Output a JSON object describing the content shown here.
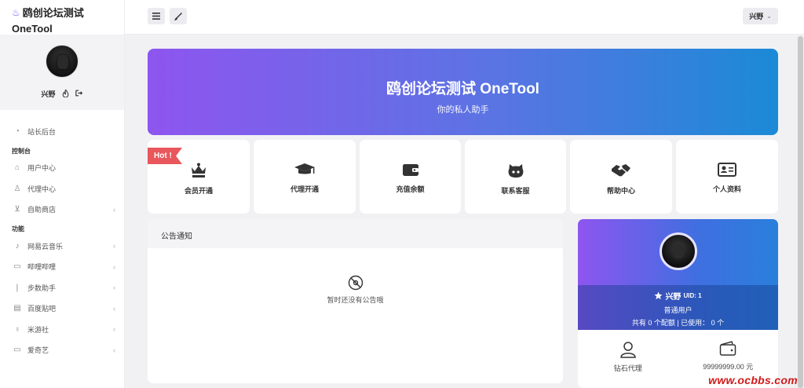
{
  "brand": {
    "title": "鸥创论坛测试",
    "subtitle": "OneTool"
  },
  "user": {
    "name": "兴野"
  },
  "sidebar": {
    "items": [
      {
        "label": "站长后台"
      }
    ],
    "group1": "控制台",
    "control": [
      {
        "label": "用户中心"
      },
      {
        "label": "代理中心"
      },
      {
        "label": "自助商店"
      }
    ],
    "group2": "功能",
    "functions": [
      {
        "label": "网易云音乐"
      },
      {
        "label": "哔哩哔哩"
      },
      {
        "label": "步数助手"
      },
      {
        "label": "百度贴吧"
      },
      {
        "label": "米游社"
      },
      {
        "label": "爱奇艺"
      }
    ]
  },
  "topbar": {
    "user_label": "兴野"
  },
  "hero": {
    "title": "鸥创论坛测试 OneTool",
    "subtitle": "你的私人助手"
  },
  "hot_label": "Hot !",
  "tiles": [
    {
      "label": "会员开通"
    },
    {
      "label": "代理开通"
    },
    {
      "label": "充值余额"
    },
    {
      "label": "联系客服"
    },
    {
      "label": "帮助中心"
    },
    {
      "label": "个人资料"
    }
  ],
  "notice": {
    "title": "公告通知",
    "empty_text": "暂时还没有公告哦"
  },
  "profile": {
    "name": "兴野",
    "uid": "UID: 1",
    "role": "普通用户",
    "quota": "共有 0 个配额 | 已使用： 0 个",
    "stats": [
      {
        "label": "钻石代理"
      },
      {
        "label": "99999999.00 元"
      }
    ]
  },
  "watermark": "www.ocbbs.com",
  "colors": {
    "accent_start": "#8e55ef",
    "accent_end": "#1b8ad6",
    "hot": "#e8575b"
  }
}
